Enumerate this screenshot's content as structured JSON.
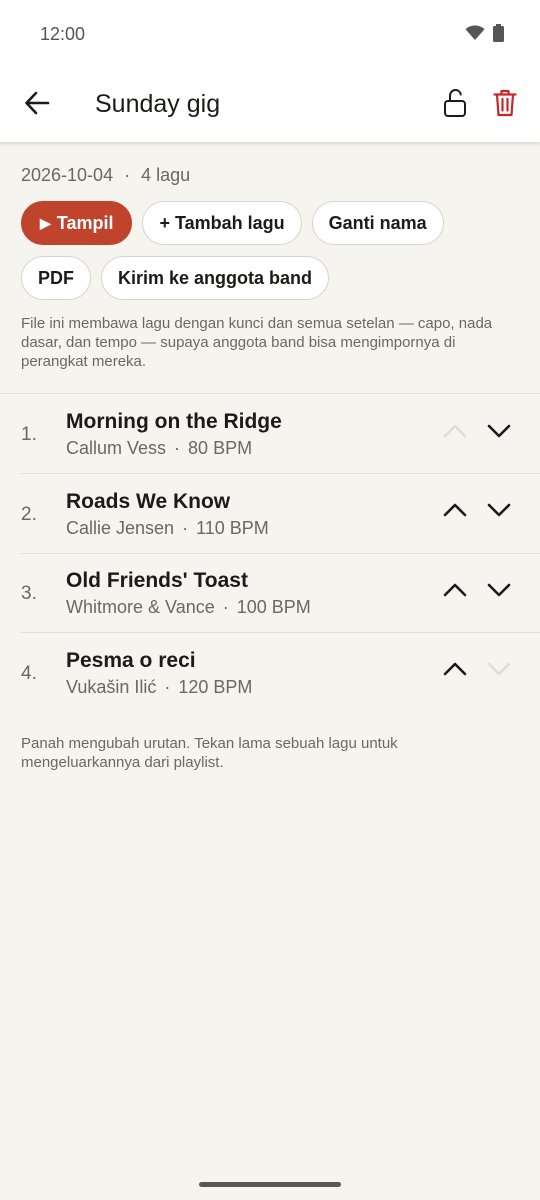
{
  "status_bar": {
    "time": "12:00"
  },
  "header": {
    "title": "Sunday gig"
  },
  "meta": {
    "date": "2026-10-04",
    "separator": "·",
    "count": "4 lagu"
  },
  "actions": {
    "play_label": "Tampil",
    "add_song_label": "+ Tambah lagu",
    "rename_label": "Ganti nama",
    "pdf_label": "PDF",
    "send_label": "Kirim ke anggota band"
  },
  "info_text": "File ini membawa lagu dengan kunci dan semua setelan — capo, nada dasar, dan tempo — supaya anggota band bisa mengimpornya di perangkat mereka.",
  "songs": [
    {
      "number": "1.",
      "title": "Morning on the Ridge",
      "artist": "Callum Vess",
      "bpm": "80 BPM",
      "can_move_up": false,
      "can_move_down": true
    },
    {
      "number": "2.",
      "title": "Roads We Know",
      "artist": "Callie Jensen",
      "bpm": "110 BPM",
      "can_move_up": true,
      "can_move_down": true
    },
    {
      "number": "3.",
      "title": "Old Friends' Toast",
      "artist": "Whitmore & Vance",
      "bpm": "100 BPM",
      "can_move_up": true,
      "can_move_down": true
    },
    {
      "number": "4.",
      "title": "Pesma o reci",
      "artist": "Vukašin Ilić",
      "bpm": "120 BPM",
      "can_move_up": true,
      "can_move_down": false
    }
  ],
  "hint_text": "Panah mengubah urutan. Tekan lama sebuah lagu untuk mengeluarkannya dari playlist.",
  "icons": {
    "back": "arrow-back-icon",
    "lock": "lock-open-icon",
    "delete": "trash-icon",
    "wifi": "wifi-icon",
    "battery": "battery-icon",
    "play": "play-icon",
    "up": "chevron-up-icon",
    "down": "chevron-down-icon"
  },
  "colors": {
    "accent": "#c0442c",
    "delete": "#c62828",
    "background": "#f6f4ee",
    "arrow_active": "#1c1b1a",
    "arrow_disabled": "#e0ddd6"
  }
}
